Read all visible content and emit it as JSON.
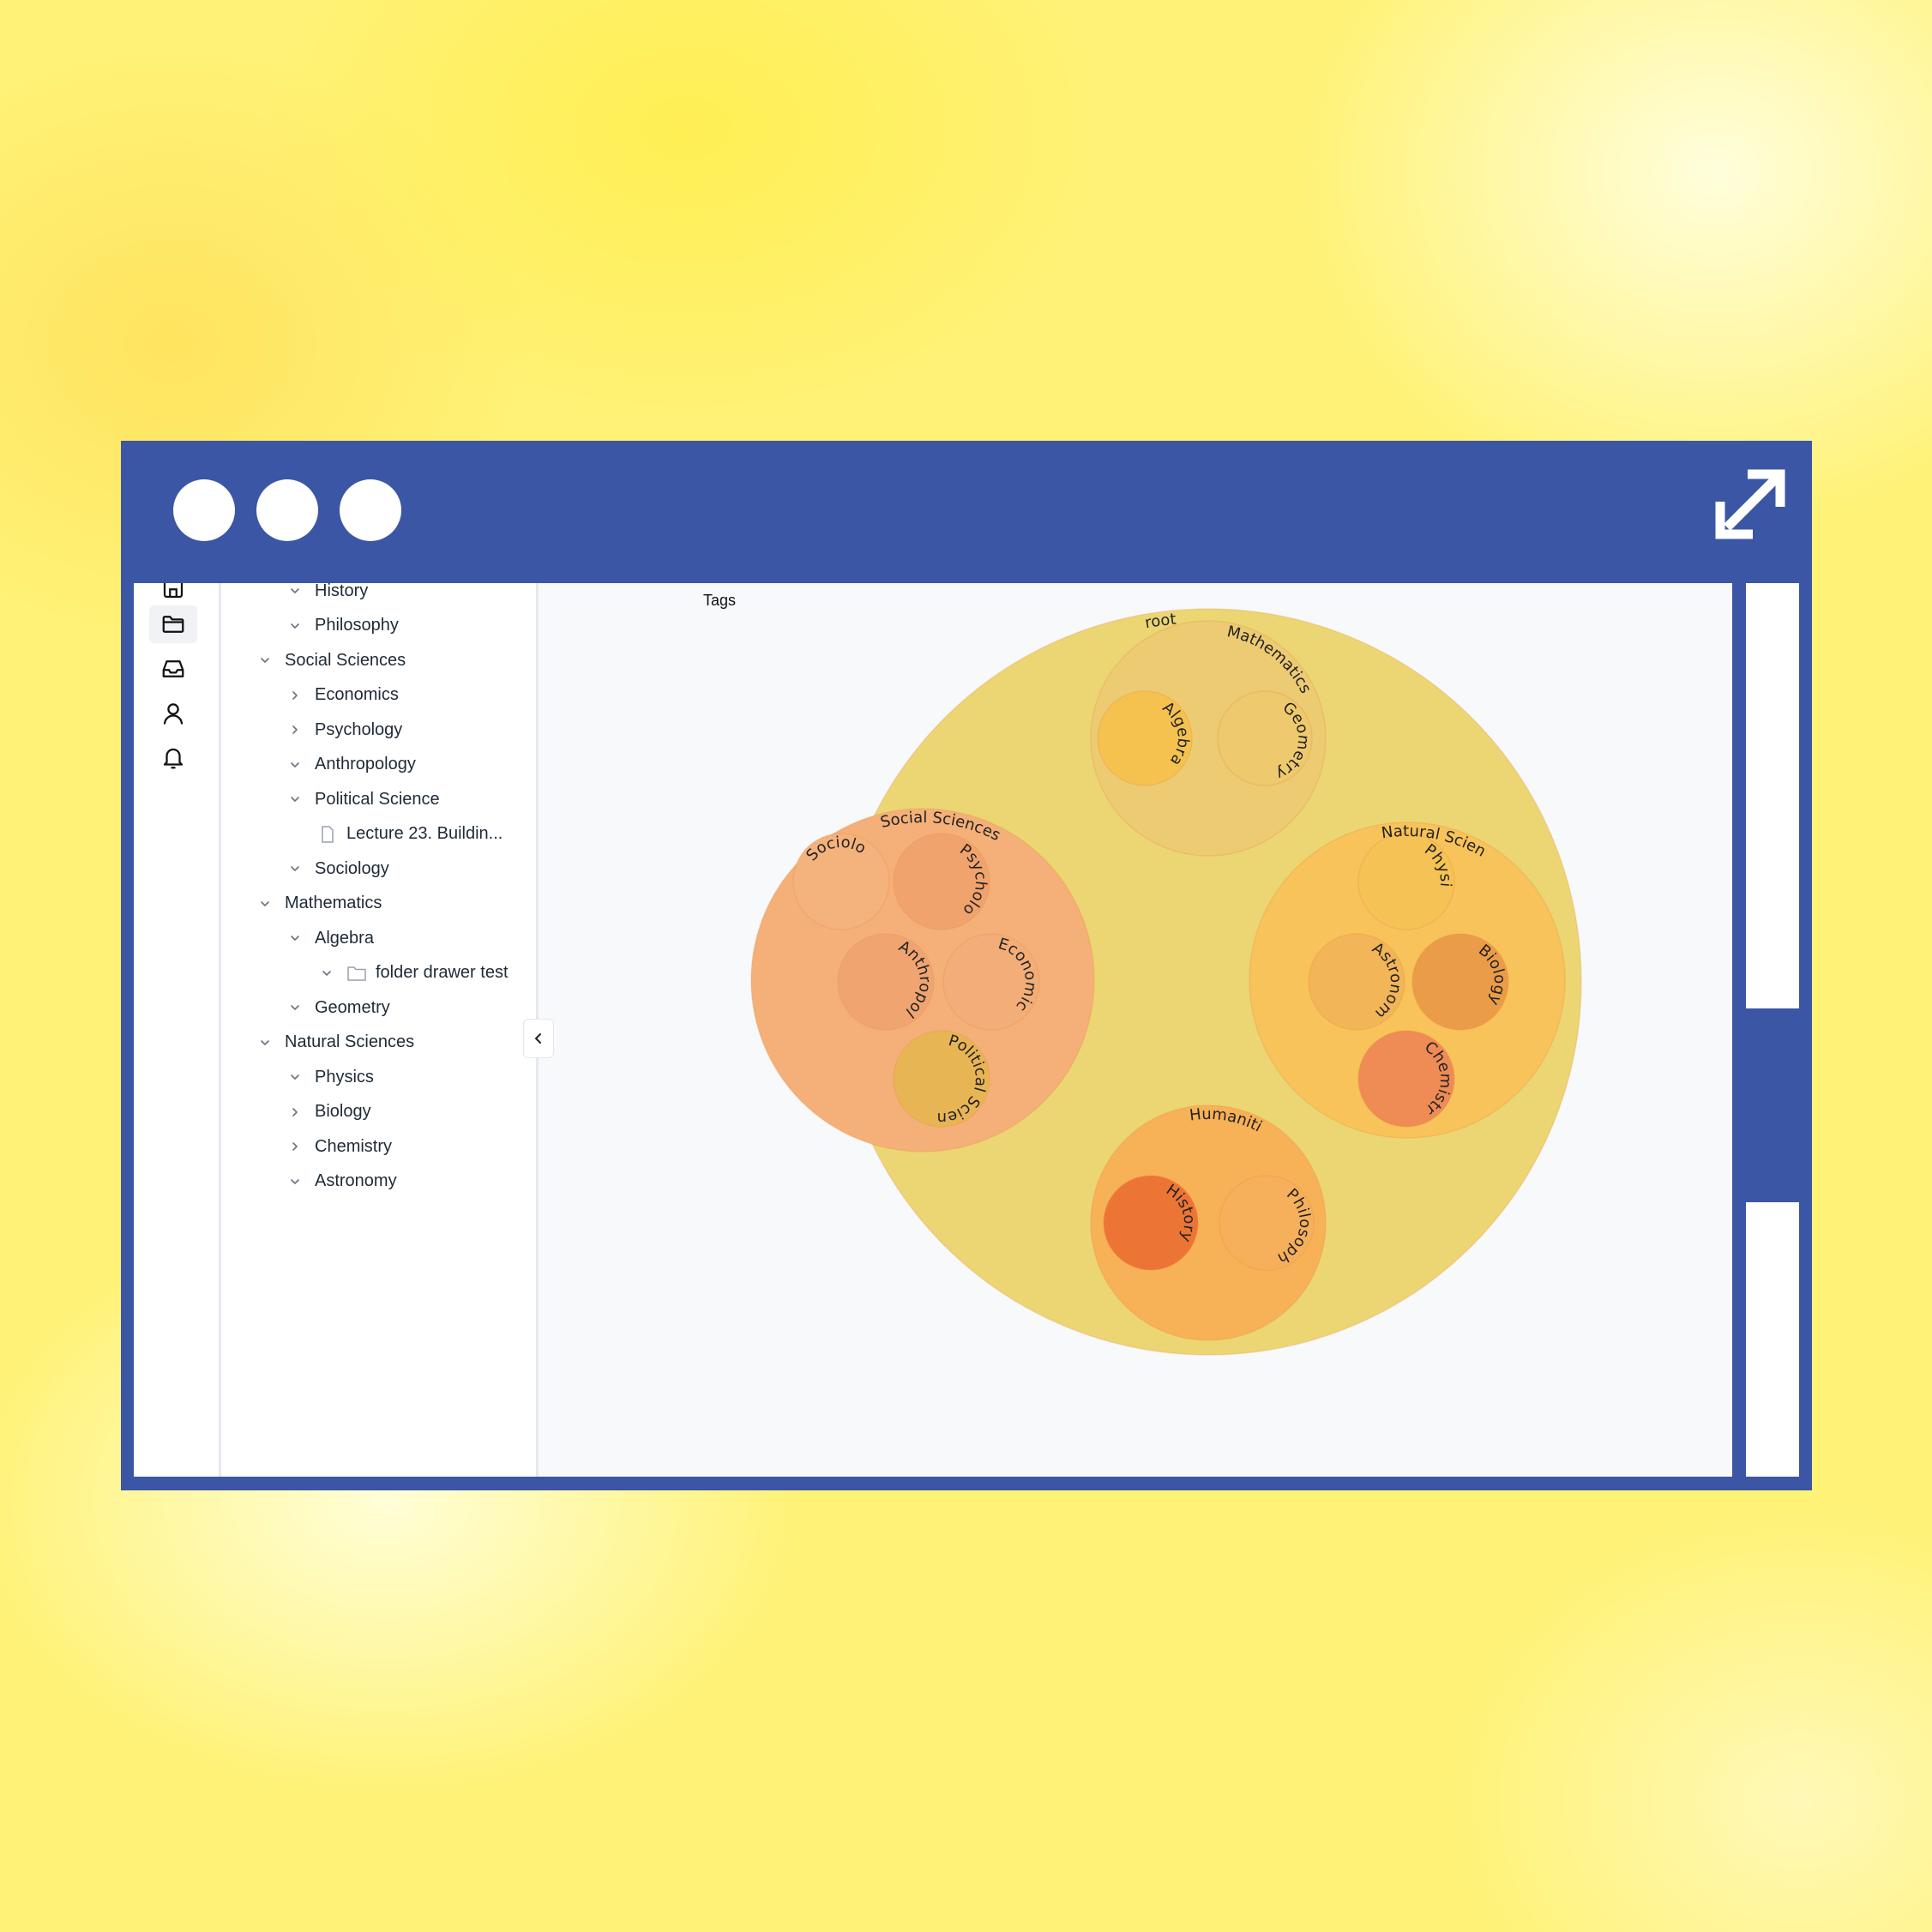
{
  "window": {
    "title_dots": 3,
    "expand_icon": "expand-arrows-icon",
    "frame_color": "#3b56a4"
  },
  "rail": {
    "icons": [
      "home-icon",
      "folder-icon",
      "inbox-icon",
      "user-icon",
      "bell-icon"
    ],
    "active": "folder-icon"
  },
  "tree": {
    "items": [
      {
        "label": "History",
        "level": 1,
        "chevron": "down"
      },
      {
        "label": "Philosophy",
        "level": 1,
        "chevron": "down"
      },
      {
        "label": "Social Sciences",
        "level": 0,
        "chevron": "down"
      },
      {
        "label": "Economics",
        "level": 1,
        "chevron": "right"
      },
      {
        "label": "Psychology",
        "level": 1,
        "chevron": "right"
      },
      {
        "label": "Anthropology",
        "level": 1,
        "chevron": "down"
      },
      {
        "label": "Political Science",
        "level": 1,
        "chevron": "down"
      },
      {
        "label": "Lecture 23. Buildin...",
        "level": 2,
        "chevron": "none",
        "icon": "file-icon"
      },
      {
        "label": "Sociology",
        "level": 1,
        "chevron": "down"
      },
      {
        "label": "Mathematics",
        "level": 0,
        "chevron": "down"
      },
      {
        "label": "Algebra",
        "level": 1,
        "chevron": "down"
      },
      {
        "label": "folder drawer test",
        "level": 2,
        "chevron": "down",
        "icon": "folder-icon"
      },
      {
        "label": "Geometry",
        "level": 1,
        "chevron": "down"
      },
      {
        "label": "Natural Sciences",
        "level": 0,
        "chevron": "down"
      },
      {
        "label": "Physics",
        "level": 1,
        "chevron": "down"
      },
      {
        "label": "Biology",
        "level": 1,
        "chevron": "right"
      },
      {
        "label": "Chemistry",
        "level": 1,
        "chevron": "right"
      },
      {
        "label": "Astronomy",
        "level": 1,
        "chevron": "down"
      }
    ],
    "collapse_icon": "chevron-left-icon"
  },
  "main": {
    "title": "Tags"
  },
  "pack": {
    "nodes": [
      {
        "id": "root",
        "label": "root",
        "color": "#ecd673"
      },
      {
        "id": "math",
        "label": "Mathematics",
        "color": "#eccb73"
      },
      {
        "id": "algebra",
        "label": "Algebra",
        "color": "#f5c250"
      },
      {
        "id": "geometry",
        "label": "Geometry",
        "color": "#eec96e"
      },
      {
        "id": "social",
        "label": "Social Sciences",
        "color": "#f4b078"
      },
      {
        "id": "sociology",
        "label": "Sociology",
        "color": "#f4b27c"
      },
      {
        "id": "psychology",
        "label": "Psychology",
        "color": "#f1a36e"
      },
      {
        "id": "anthropology",
        "label": "Anthropology",
        "color": "#f0a570"
      },
      {
        "id": "economics",
        "label": "Economics",
        "color": "#f3ad78"
      },
      {
        "id": "polisci",
        "label": "Political Science",
        "color": "#e8b555"
      },
      {
        "id": "natural",
        "label": "Natural Sciences",
        "color": "#f7c35a"
      },
      {
        "id": "physics",
        "label": "Physics",
        "color": "#f5c355"
      },
      {
        "id": "astronomy",
        "label": "Astronomy",
        "color": "#f2b557"
      },
      {
        "id": "biology",
        "label": "Biology",
        "color": "#eb9c48"
      },
      {
        "id": "chemistry",
        "label": "Chemistry",
        "color": "#ef8b55"
      },
      {
        "id": "humanities",
        "label": "Humanities",
        "color": "#f7b157"
      },
      {
        "id": "history",
        "label": "History",
        "color": "#ec7535"
      },
      {
        "id": "philosophy",
        "label": "Philosophy",
        "color": "#f6b05c"
      }
    ]
  }
}
